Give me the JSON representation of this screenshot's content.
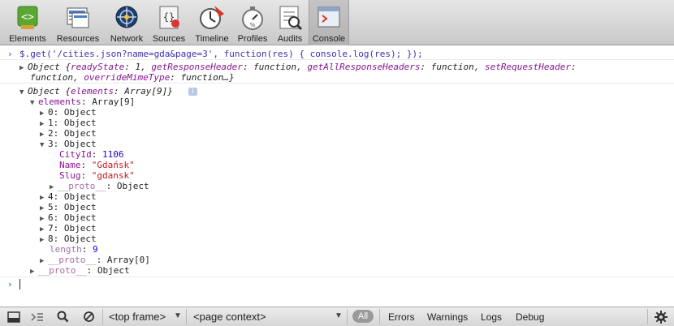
{
  "toolbar": {
    "items": [
      {
        "id": "elements",
        "label": "Elements",
        "icon": "elements-icon"
      },
      {
        "id": "resources",
        "label": "Resources",
        "icon": "resources-icon"
      },
      {
        "id": "network",
        "label": "Network",
        "icon": "network-icon"
      },
      {
        "id": "sources",
        "label": "Sources",
        "icon": "sources-icon"
      },
      {
        "id": "timeline",
        "label": "Timeline",
        "icon": "timeline-icon"
      },
      {
        "id": "profiles",
        "label": "Profiles",
        "icon": "profiles-icon"
      },
      {
        "id": "audits",
        "label": "Audits",
        "icon": "audits-icon"
      },
      {
        "id": "console",
        "label": "Console",
        "icon": "console-icon",
        "active": true
      }
    ]
  },
  "console": {
    "prompt_glyph": "›",
    "command": "$.get('/cities.json?name=gda&page=3', function(res) { console.log(res); });",
    "result": {
      "line1_prefix": "Object {",
      "readyState_key": "readyState",
      "readyState_val": ": 1, ",
      "getResponseHeader_key": "getResponseHeader",
      "fn1": ": function, ",
      "getAllResponseHeaders_key": "getAllResponseHeaders",
      "fn2": ": function, ",
      "setRequestHeader_key": "setRequestHeader",
      "colon": ":",
      "line2_prefix": "function, ",
      "overrideMimeType_key": "overrideMimeType",
      "line2_suffix": ": function…}"
    },
    "log": {
      "head_prefix": "Object {",
      "head_key": "elements",
      "head_suffix": ": Array[9]}",
      "info_badge": "i",
      "elements_key": "elements",
      "elements_val": ": Array[9]",
      "items": [
        {
          "label": "0: Object",
          "expanded": false
        },
        {
          "label": "1: Object",
          "expanded": false
        },
        {
          "label": "2: Object",
          "expanded": false
        },
        {
          "label": "3: Object",
          "expanded": true
        },
        {
          "label": "4: Object",
          "expanded": false
        },
        {
          "label": "5: Object",
          "expanded": false
        },
        {
          "label": "6: Object",
          "expanded": false
        },
        {
          "label": "7: Object",
          "expanded": false
        },
        {
          "label": "8: Object",
          "expanded": false
        }
      ],
      "expanded_props": [
        {
          "key": "CityId",
          "value": "1106",
          "kind": "number"
        },
        {
          "key": "Name",
          "value": "\"Gdańsk\"",
          "kind": "string"
        },
        {
          "key": "Slug",
          "value": "\"gdansk\"",
          "kind": "string"
        }
      ],
      "inner_proto_key": "__proto__",
      "inner_proto_val": ": Object",
      "length_key": "length",
      "length_val": "9",
      "array_proto_key": "__proto__",
      "array_proto_val": ": Array[0]",
      "outer_proto_key": "__proto__",
      "outer_proto_val": ": Object"
    }
  },
  "statusbar": {
    "dock_icon": "dock-icon",
    "drawer_icon": "show-console-icon",
    "search_icon": "search-icon",
    "clear_icon": "clear-console-icon",
    "frame_select": "<top frame>",
    "context_select": "<page context>",
    "filters": [
      "All",
      "Errors",
      "Warnings",
      "Logs",
      "Debug"
    ],
    "active_filter": "All",
    "settings_icon": "gear-icon"
  },
  "colors": {
    "prompt": "#2f79d4",
    "command": "#3b2fae",
    "key": "#881391",
    "number": "#1c00cf",
    "string": "#c41a16",
    "proto": "#a56da5",
    "active_pill": "#9a9a9a"
  }
}
